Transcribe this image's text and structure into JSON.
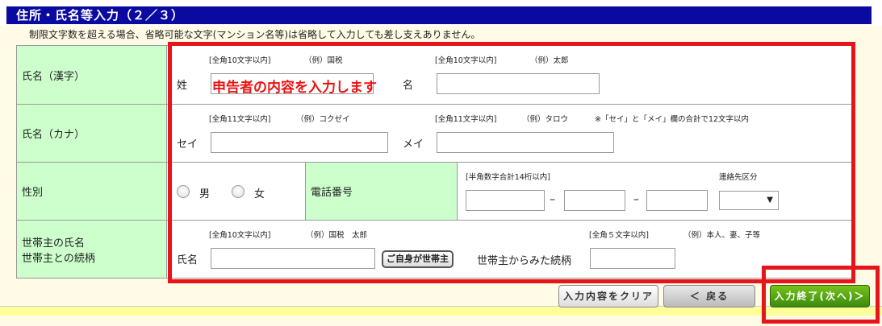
{
  "section_title": "住所・氏名等入力（２／３）",
  "note": "制限文字数を超える場合、省略可能な文字(マンション名等)は省略して入力しても差し支えありません。",
  "rows": {
    "name_kanji": {
      "label": "氏名（漢字）",
      "sei_hint": "[全角10文字以内]",
      "sei_example": "（例）国税",
      "sei_label": "姓",
      "mei_hint": "[全角10文字以内]",
      "mei_example": "（例）太郎",
      "mei_label": "名",
      "overlay_text": "申告者の内容を入力します"
    },
    "name_kana": {
      "label": "氏名（カナ）",
      "sei_hint": "[全角11文字以内]",
      "sei_example": "（例）コクゼイ",
      "sei_label": "セイ",
      "mei_hint": "[全角11文字以内]",
      "mei_example": "（例）タロウ",
      "mei_label": "メイ",
      "total_note": "※「セイ」と「メイ」欄の合計で12文字以内"
    },
    "gender": {
      "label": "性別",
      "male": "男",
      "female": "女"
    },
    "phone": {
      "label": "電話番号",
      "hint": "[半角数字合計14桁以内]",
      "dash": "–",
      "contact_type_label": "連絡先区分"
    },
    "household": {
      "label_line1": "世帯主の氏名",
      "label_line2": "世帯主との続柄",
      "name_hint": "[全角10文字以内]",
      "name_example": "（例）国税　太郎",
      "name_label": "氏名",
      "self_button": "ご自身が世帯主",
      "relation_hint": "[全角５文字以内]",
      "relation_example": "（例）本人、妻、子等",
      "relation_label": "世帯主からみた続柄"
    }
  },
  "buttons": {
    "clear": "入力内容をクリア",
    "back": "＜ 戻る",
    "next": "入力終了(次へ)＞"
  },
  "colors": {
    "title_bar": "#0a0aa0",
    "label_bg": "#ccffcc",
    "highlight_red": "#e8141b",
    "next_green": "#4f9e14"
  }
}
